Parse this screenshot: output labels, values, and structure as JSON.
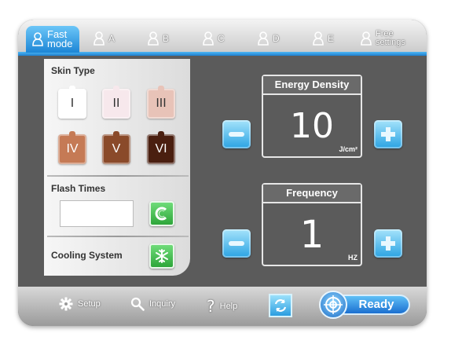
{
  "tabs": [
    {
      "label": "Fast\nmode",
      "icon": "person-icon",
      "active": true
    },
    {
      "label": "A",
      "icon": "person-icon"
    },
    {
      "label": "B",
      "icon": "person-icon"
    },
    {
      "label": "C",
      "icon": "person-icon"
    },
    {
      "label": "D",
      "icon": "person-icon"
    },
    {
      "label": "E",
      "icon": "person-icon"
    },
    {
      "label": "Free\nsettings",
      "icon": "person-icon"
    }
  ],
  "skin_type": {
    "title": "Skin Type",
    "types": [
      {
        "label": "I",
        "color": "#ffffff",
        "text_color": "#333333"
      },
      {
        "label": "II",
        "color": "#f7e8ec",
        "text_color": "#333333"
      },
      {
        "label": "III",
        "color": "#e8c3b8",
        "text_color": "#333333"
      },
      {
        "label": "IV",
        "color": "#c57a55",
        "text_color": "#ffffff"
      },
      {
        "label": "V",
        "color": "#8a4a2a",
        "text_color": "#ffffff"
      },
      {
        "label": "VI",
        "color": "#4a1f10",
        "text_color": "#ffffff"
      }
    ]
  },
  "flash_times": {
    "title": "Flash Times",
    "value": ""
  },
  "cooling": {
    "title": "Cooling System",
    "icon": "snowflake-icon"
  },
  "energy": {
    "title": "Energy Density",
    "value": "10",
    "unit": "J/cm²"
  },
  "frequency": {
    "title": "Frequency",
    "value": "1",
    "unit": "HZ"
  },
  "bottom": {
    "setup": "Setup",
    "inquiry": "Inquiry",
    "help": "Help",
    "ready": "Ready"
  },
  "colors": {
    "accent": "#1e86d6",
    "frame": "#5b5b5b",
    "green": "#3bb548"
  }
}
